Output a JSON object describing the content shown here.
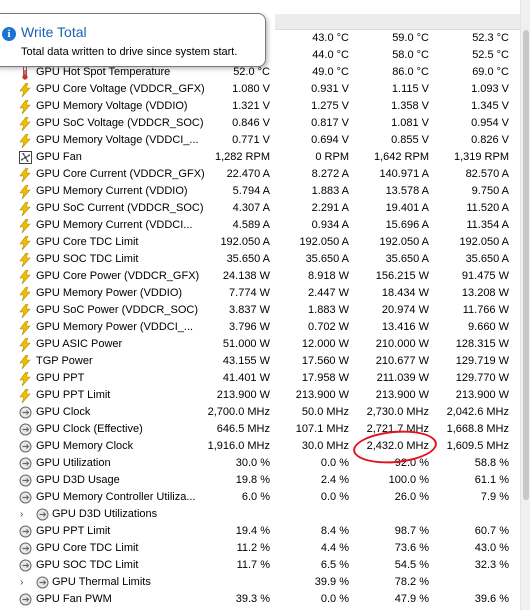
{
  "tooltip": {
    "icon": "info-icon",
    "title": "Write Total",
    "body": "Total data written to drive since system start."
  },
  "rows": [
    {
      "icon": "temperature-icon",
      "name": "",
      "values": [
        "",
        "43.0 °C",
        "59.0 °C",
        "52.3 °C"
      ]
    },
    {
      "icon": "temperature-icon",
      "name": "",
      "values": [
        "",
        "44.0 °C",
        "58.0 °C",
        "52.5 °C"
      ]
    },
    {
      "icon": "temperature-icon",
      "name": "GPU Hot Spot Temperature",
      "values": [
        "52.0 °C",
        "49.0 °C",
        "86.0 °C",
        "69.0 °C"
      ]
    },
    {
      "icon": "lightning-icon",
      "name": "GPU Core Voltage (VDDCR_GFX)",
      "values": [
        "1.080 V",
        "0.931 V",
        "1.115 V",
        "1.093 V"
      ]
    },
    {
      "icon": "lightning-icon",
      "name": "GPU Memory Voltage (VDDIO)",
      "values": [
        "1.321 V",
        "1.275 V",
        "1.358 V",
        "1.345 V"
      ]
    },
    {
      "icon": "lightning-icon",
      "name": "GPU SoC Voltage (VDDCR_SOC)",
      "values": [
        "0.846 V",
        "0.817 V",
        "1.081 V",
        "0.954 V"
      ]
    },
    {
      "icon": "lightning-icon",
      "name": "GPU Memory Voltage (VDDCI_...",
      "values": [
        "0.771 V",
        "0.694 V",
        "0.855 V",
        "0.826 V"
      ]
    },
    {
      "icon": "fan-icon",
      "name": "GPU Fan",
      "values": [
        "1,282 RPM",
        "0 RPM",
        "1,642 RPM",
        "1,319 RPM"
      ]
    },
    {
      "icon": "lightning-icon",
      "name": "GPU Core Current (VDDCR_GFX)",
      "values": [
        "22.470 A",
        "8.272 A",
        "140.971 A",
        "82.570 A"
      ]
    },
    {
      "icon": "lightning-icon",
      "name": "GPU Memory Current (VDDIO)",
      "values": [
        "5.794 A",
        "1.883 A",
        "13.578 A",
        "9.750 A"
      ]
    },
    {
      "icon": "lightning-icon",
      "name": "GPU SoC Current (VDDCR_SOC)",
      "values": [
        "4.307 A",
        "2.291 A",
        "19.401 A",
        "11.520 A"
      ]
    },
    {
      "icon": "lightning-icon",
      "name": "GPU Memory Current (VDDCI...",
      "values": [
        "4.589 A",
        "0.934 A",
        "15.696 A",
        "11.354 A"
      ]
    },
    {
      "icon": "lightning-icon",
      "name": "GPU Core TDC Limit",
      "values": [
        "192.050 A",
        "192.050 A",
        "192.050 A",
        "192.050 A"
      ]
    },
    {
      "icon": "lightning-icon",
      "name": "GPU SOC TDC Limit",
      "values": [
        "35.650 A",
        "35.650 A",
        "35.650 A",
        "35.650 A"
      ]
    },
    {
      "icon": "lightning-icon",
      "name": "GPU Core Power (VDDCR_GFX)",
      "values": [
        "24.138 W",
        "8.918 W",
        "156.215 W",
        "91.475 W"
      ]
    },
    {
      "icon": "lightning-icon",
      "name": "GPU Memory Power (VDDIO)",
      "values": [
        "7.774 W",
        "2.447 W",
        "18.434 W",
        "13.208 W"
      ]
    },
    {
      "icon": "lightning-icon",
      "name": "GPU SoC Power (VDDCR_SOC)",
      "values": [
        "3.837 W",
        "1.883 W",
        "20.974 W",
        "11.766 W"
      ]
    },
    {
      "icon": "lightning-icon",
      "name": "GPU Memory Power (VDDCI_...",
      "values": [
        "3.796 W",
        "0.702 W",
        "13.416 W",
        "9.660 W"
      ]
    },
    {
      "icon": "lightning-icon",
      "name": "GPU ASIC Power",
      "values": [
        "51.000 W",
        "12.000 W",
        "210.000 W",
        "128.315 W"
      ]
    },
    {
      "icon": "lightning-icon",
      "name": "TGP Power",
      "values": [
        "43.155 W",
        "17.560 W",
        "210.677 W",
        "129.719 W"
      ]
    },
    {
      "icon": "lightning-icon",
      "name": "GPU PPT",
      "values": [
        "41.401 W",
        "17.958 W",
        "211.039 W",
        "129.770 W"
      ]
    },
    {
      "icon": "lightning-icon",
      "name": "GPU PPT Limit",
      "values": [
        "213.900 W",
        "213.900 W",
        "213.900 W",
        "213.900 W"
      ]
    },
    {
      "icon": "clock-icon",
      "name": "GPU Clock",
      "values": [
        "2,700.0 MHz",
        "50.0 MHz",
        "2,730.0 MHz",
        "2,042.6 MHz"
      ]
    },
    {
      "icon": "clock-icon",
      "name": "GPU Clock (Effective)",
      "values": [
        "646.5 MHz",
        "107.1 MHz",
        "2,721.7 MHz",
        "1,668.8 MHz"
      ]
    },
    {
      "icon": "clock-icon",
      "name": "GPU Memory Clock",
      "values": [
        "1,916.0 MHz",
        "30.0 MHz",
        "2,432.0 MHz",
        "1,609.5 MHz"
      ]
    },
    {
      "icon": "clock-icon",
      "name": "GPU Utilization",
      "values": [
        "30.0 %",
        "0.0 %",
        "92.0 %",
        "58.8 %"
      ]
    },
    {
      "icon": "clock-icon",
      "name": "GPU D3D Usage",
      "values": [
        "19.8 %",
        "2.4 %",
        "100.0 %",
        "61.1 %"
      ]
    },
    {
      "icon": "clock-icon",
      "name": "GPU Memory Controller Utiliza...",
      "values": [
        "6.0 %",
        "0.0 %",
        "26.0 %",
        "7.9 %"
      ]
    },
    {
      "icon": "clock-icon",
      "name": "GPU D3D Utilizations",
      "values": [
        "",
        "",
        "",
        ""
      ],
      "group": true
    },
    {
      "icon": "clock-icon",
      "name": "GPU PPT Limit",
      "values": [
        "19.4 %",
        "8.4 %",
        "98.7 %",
        "60.7 %"
      ]
    },
    {
      "icon": "clock-icon",
      "name": "GPU Core TDC Limit",
      "values": [
        "11.2 %",
        "4.4 %",
        "73.6 %",
        "43.0 %"
      ]
    },
    {
      "icon": "clock-icon",
      "name": "GPU SOC TDC Limit",
      "values": [
        "11.7 %",
        "6.5 %",
        "54.5 %",
        "32.3 %"
      ]
    },
    {
      "icon": "clock-icon",
      "name": "GPU Thermal Limits",
      "values": [
        "",
        "39.9 %",
        "78.2 %",
        ""
      ],
      "group": true
    },
    {
      "icon": "clock-icon",
      "name": "GPU Fan PWM",
      "values": [
        "39.3 %",
        "0.0 %",
        "47.9 %",
        "39.6 %"
      ]
    }
  ],
  "colors": {
    "accent": "#1d72d6",
    "annotation": "#e0141e",
    "bolt": "#f0c000"
  }
}
